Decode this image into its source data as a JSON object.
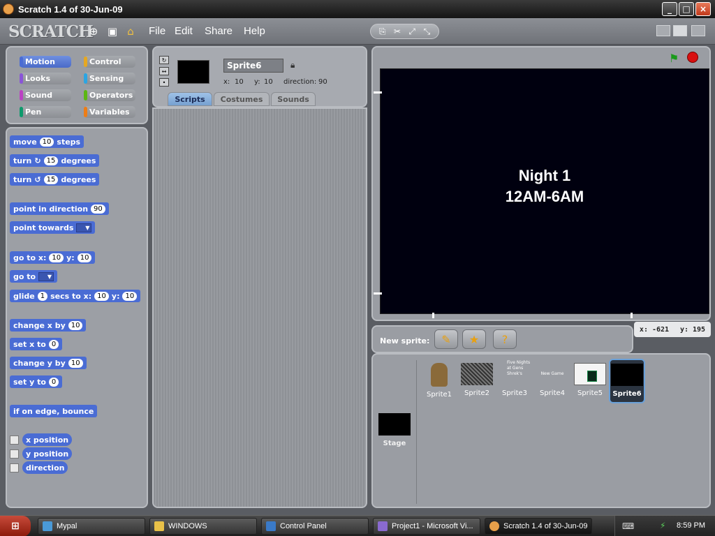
{
  "window": {
    "title": "Scratch 1.4 of 30-Jun-09",
    "buttons": [
      "_",
      "□",
      "×"
    ]
  },
  "menubar": {
    "logo": "SCRATCH",
    "items": [
      "File",
      "Edit",
      "Share",
      "Help"
    ],
    "icons": [
      "globe-icon",
      "save-icon",
      "share-icon"
    ]
  },
  "categories": [
    {
      "label": "Motion",
      "color": "#4a6cd4",
      "active": true
    },
    {
      "label": "Control",
      "color": "#e6a822"
    },
    {
      "label": "Looks",
      "color": "#8a55d7"
    },
    {
      "label": "Sensing",
      "color": "#2ca5e2"
    },
    {
      "label": "Sound",
      "color": "#bb42c3"
    },
    {
      "label": "Operators",
      "color": "#5cb712"
    },
    {
      "label": "Pen",
      "color": "#0e9a6c"
    },
    {
      "label": "Variables",
      "color": "#ee7d16"
    }
  ],
  "blocks": {
    "move": {
      "pre": "move",
      "v": "10",
      "post": "steps"
    },
    "turn_cw": {
      "pre": "turn",
      "v": "15",
      "post": "degrees"
    },
    "turn_ccw": {
      "pre": "turn",
      "v": "15",
      "post": "degrees"
    },
    "point_dir": {
      "pre": "point in direction",
      "v": "90"
    },
    "point_towards": {
      "pre": "point towards"
    },
    "goto_xy": {
      "pre": "go to x:",
      "x": "10",
      "mid": "y:",
      "y": "10"
    },
    "goto": {
      "pre": "go to"
    },
    "glide": {
      "pre": "glide",
      "s": "1",
      "mid1": "secs to x:",
      "x": "10",
      "mid2": "y:",
      "y": "10"
    },
    "change_x": {
      "pre": "change x by",
      "v": "10"
    },
    "set_x": {
      "pre": "set x to",
      "v": "0"
    },
    "change_y": {
      "pre": "change y by",
      "v": "10"
    },
    "set_y": {
      "pre": "set y to",
      "v": "0"
    },
    "bounce": {
      "pre": "if on edge, bounce"
    },
    "x_position": "x position",
    "y_position": "y position",
    "direction": "direction"
  },
  "sprite": {
    "name": "Sprite6",
    "x_label": "x:",
    "x": "10",
    "y_label": "y:",
    "y": "10",
    "dir_label": "direction:",
    "direction": "90"
  },
  "tabs": [
    "Scripts",
    "Costumes",
    "Sounds"
  ],
  "stage": {
    "line1": "Night 1",
    "line2": "12AM-6AM"
  },
  "mouse": {
    "x_label": "x:",
    "x": "-621",
    "y_label": "y:",
    "y": "195"
  },
  "new_sprite": {
    "label": "New sprite:"
  },
  "sprites": [
    {
      "name": "Sprite1"
    },
    {
      "name": "Sprite2"
    },
    {
      "name": "Sprite3",
      "preview": "Five Nights at Gens Shrek's"
    },
    {
      "name": "Sprite4",
      "preview": "New Game"
    },
    {
      "name": "Sprite5"
    },
    {
      "name": "Sprite6",
      "selected": true
    }
  ],
  "stage_tile": {
    "name": "Stage"
  },
  "taskbar": {
    "start": "⊞",
    "tasks": [
      {
        "label": "Mypal",
        "color": "#4a9ad8"
      },
      {
        "label": "WINDOWS",
        "color": "#e8c048"
      },
      {
        "label": "Control Panel",
        "color": "#3a7ac8"
      },
      {
        "label": "Project1 - Microsoft Vi...",
        "color": "#8a6ad0"
      },
      {
        "label": "Scratch 1.4 of 30-Jun-09",
        "color": "#e8a04a",
        "active": true
      }
    ],
    "clock": "8:59 PM"
  }
}
